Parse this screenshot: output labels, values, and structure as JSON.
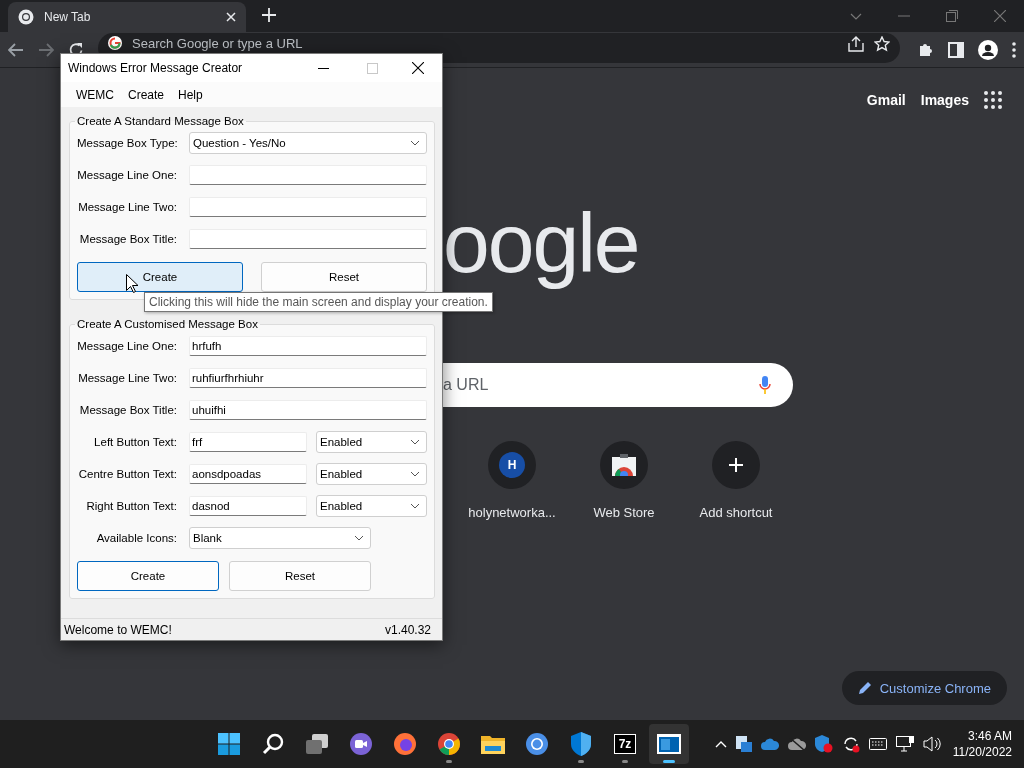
{
  "browser": {
    "tabs": [
      {
        "title": "New Tab",
        "selected": true
      }
    ],
    "omnibox": {
      "placeholder": "Search Google or type a URL"
    },
    "header_links": [
      "Gmail",
      "Images"
    ],
    "logo": "oogle",
    "search": {
      "placeholder": "a URL"
    },
    "shortcuts": [
      {
        "label": "holynetworka...",
        "kind": "letter",
        "letter": "H"
      },
      {
        "label": "Web Store",
        "kind": "store"
      },
      {
        "label": "Add shortcut",
        "kind": "add"
      }
    ],
    "customize_button": "Customize Chrome"
  },
  "dialog": {
    "title": "Windows Error Message Creator",
    "menu": [
      "WEMC",
      "Create",
      "Help"
    ],
    "groups": [
      {
        "title": "Create A Standard Message Box",
        "fields": [
          {
            "label": "Message Box Type:",
            "kind": "select",
            "value": "Question - Yes/No"
          },
          {
            "label": "Message Line One:",
            "kind": "text"
          },
          {
            "label": "Message Line Two:",
            "kind": "text"
          },
          {
            "label": "Message Box Title:",
            "kind": "text"
          }
        ],
        "buttons": [
          {
            "label": "Create",
            "hovered": true,
            "focused": false
          },
          {
            "label": "Reset",
            "hovered": false,
            "focused": false
          }
        ]
      },
      {
        "title": "Create A Customised Message Box",
        "fields": [
          {
            "label": "Message Line One:",
            "kind": "text",
            "value": "hrfufh"
          },
          {
            "label": "Message Line Two:",
            "kind": "text",
            "value": "ruhfiurfhrhiuhr"
          },
          {
            "label": "Message Box Title:",
            "kind": "text",
            "value": "uhuifhi"
          },
          {
            "label": "Left Button Text:",
            "kind": "text_select",
            "value": "frf",
            "option": "Enabled"
          },
          {
            "label": "Centre Button Text:",
            "kind": "text_select",
            "value": "aonsdpoadas",
            "option": "Enabled"
          },
          {
            "label": "Right Button Text:",
            "kind": "text_select",
            "value": "dasnod",
            "option": "Enabled"
          },
          {
            "label": "Available Icons:",
            "kind": "select_short",
            "value": "Blank"
          }
        ],
        "buttons": [
          {
            "label": "Create",
            "hovered": false,
            "focused": true
          },
          {
            "label": "Reset",
            "hovered": false,
            "focused": false
          }
        ]
      }
    ],
    "tooltip": "Clicking this will hide the main screen and display your creation.",
    "status": {
      "message": "Welcome to WEMC!",
      "version": "v1.40.32"
    }
  },
  "taskbar": {
    "apps": [
      {
        "kind": "start",
        "running": false,
        "selected": false
      },
      {
        "kind": "search",
        "running": false,
        "selected": false
      },
      {
        "kind": "taskview",
        "running": false,
        "selected": false
      },
      {
        "kind": "chat",
        "running": false,
        "selected": false
      },
      {
        "kind": "firefox",
        "running": false,
        "selected": false
      },
      {
        "kind": "chrome",
        "running": true,
        "selected": false
      },
      {
        "kind": "folder",
        "running": false,
        "selected": false
      },
      {
        "kind": "chromium",
        "running": false,
        "selected": false
      },
      {
        "kind": "shield",
        "running": true,
        "selected": false
      },
      {
        "kind": "archiver",
        "label": "7z",
        "running": true,
        "selected": false
      },
      {
        "kind": "window",
        "running": true,
        "selected": true
      }
    ],
    "clock": {
      "time": "3:46 AM",
      "date": "11/20/2022"
    }
  }
}
